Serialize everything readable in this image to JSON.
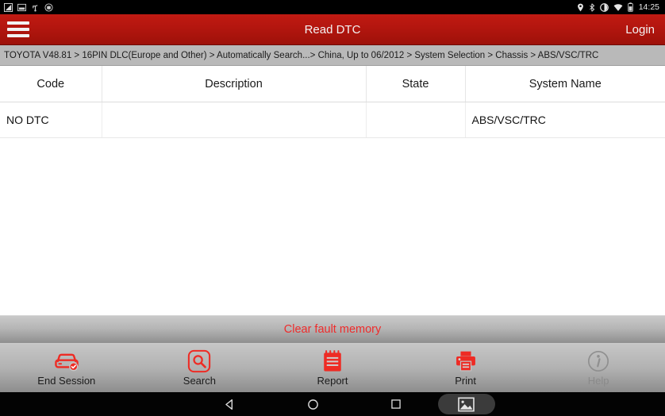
{
  "status_bar": {
    "time": "14:25",
    "left_icons": [
      "sim-card-icon",
      "sd-card-icon",
      "usb-icon",
      "vci-connect-icon"
    ],
    "right_icons": [
      "location-icon",
      "bluetooth-icon",
      "do-not-disturb-icon",
      "wifi-icon",
      "battery-icon"
    ]
  },
  "app_bar": {
    "menu_icon": "hamburger-menu-icon",
    "title": "Read DTC",
    "login_label": "Login",
    "background_color": "#b4160f"
  },
  "breadcrumb": {
    "text": "TOYOTA V48.81 > 16PIN DLC(Europe and Other) > Automatically Search...> China, Up to 06/2012 > System Selection > Chassis > ABS/VSC/TRC"
  },
  "table": {
    "columns": [
      "Code",
      "Description",
      "State",
      "System Name"
    ],
    "rows": [
      {
        "code": "NO DTC",
        "description": "",
        "state": "",
        "system_name": "ABS/VSC/TRC"
      }
    ]
  },
  "clear_button": {
    "label": "Clear fault memory",
    "text_color": "#ef2b2b"
  },
  "toolbar": {
    "accent_color": "#ee2b24",
    "items": [
      {
        "label": "End Session",
        "icon": "car-check-icon",
        "disabled": false
      },
      {
        "label": "Search",
        "icon": "search-icon",
        "disabled": false
      },
      {
        "label": "Report",
        "icon": "report-notepad-icon",
        "disabled": false
      },
      {
        "label": "Print",
        "icon": "printer-icon",
        "disabled": false
      },
      {
        "label": "Help",
        "icon": "info-circle-icon",
        "disabled": true
      }
    ]
  },
  "nav_bar": {
    "buttons": [
      "back-icon",
      "home-icon",
      "recents-icon",
      "screenshot-icon"
    ]
  }
}
